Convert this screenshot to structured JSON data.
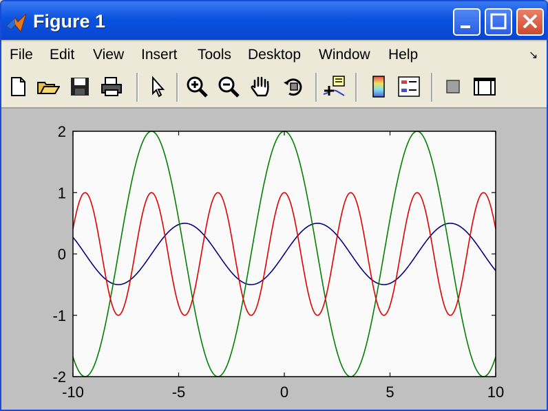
{
  "window": {
    "title": "Figure 1"
  },
  "menu": [
    "File",
    "Edit",
    "View",
    "Insert",
    "Tools",
    "Desktop",
    "Window",
    "Help"
  ],
  "toolbar_icons": [
    "new-figure-icon",
    "open-file-icon",
    "save-icon",
    "print-icon",
    "edit-plot-arrow-icon",
    "zoom-in-icon",
    "zoom-out-icon",
    "pan-hand-icon",
    "rotate-3d-icon",
    "data-cursor-icon",
    "insert-colorbar-icon",
    "insert-legend-icon",
    "hide-plot-tools-icon",
    "show-plot-tools-icon"
  ],
  "chart_data": {
    "type": "line",
    "xlim": [
      -10,
      10
    ],
    "ylim": [
      -2,
      2
    ],
    "xticks": [
      "-10",
      "-5",
      "0",
      "5",
      "10"
    ],
    "yticks": [
      "2",
      "1",
      "0",
      "-1",
      "-2"
    ],
    "grid": false,
    "series": [
      {
        "color": "#00007f",
        "function": "0.5*sin(x)",
        "amplitude": 0.5,
        "frequency": 1
      },
      {
        "color": "#007f00",
        "function": "2*cos(x)",
        "amplitude": 2,
        "frequency": 1
      },
      {
        "color": "#e00000",
        "function": "cos(2x)",
        "amplitude": 1,
        "frequency": 2
      }
    ]
  }
}
